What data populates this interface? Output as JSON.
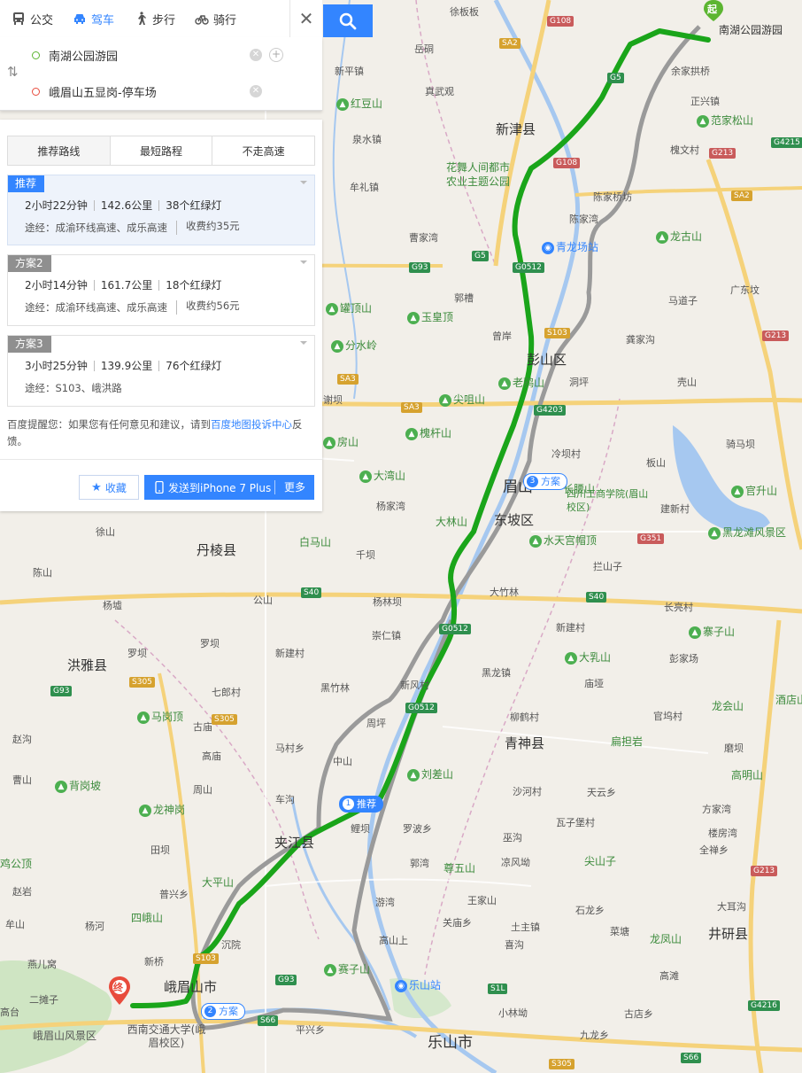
{
  "top_tabs": [
    {
      "label": "公交",
      "icon": "bus-icon"
    },
    {
      "label": "驾车",
      "icon": "car-icon",
      "active": true
    },
    {
      "label": "步行",
      "icon": "walk-icon"
    },
    {
      "label": "骑行",
      "icon": "bike-icon"
    }
  ],
  "route": {
    "origin": "南湖公园游园",
    "destination": "峨眉山五显岗-停车场"
  },
  "options": [
    "推荐路线",
    "最短路程",
    "不走高速"
  ],
  "plans": [
    {
      "badge": "推荐",
      "time": "2小时22分钟",
      "distance": "142.6公里",
      "lights": "38个红绿灯",
      "via": "途经：成渝环线高速、成乐高速",
      "fee": "收费约35元"
    },
    {
      "badge": "方案2",
      "time": "2小时14分钟",
      "distance": "161.7公里",
      "lights": "18个红绿灯",
      "via": "途经：成渝环线高速、成乐高速",
      "fee": "收费约56元"
    },
    {
      "badge": "方案3",
      "time": "3小时25分钟",
      "distance": "139.9公里",
      "lights": "76个红绿灯",
      "via": "途经：S103、峨洪路",
      "fee": ""
    }
  ],
  "tip": {
    "before": "百度提醒您：如果您有任何意见和建议，请到",
    "link": "百度地图投诉中心",
    "after": "反馈。"
  },
  "actions": {
    "favorite": "收藏",
    "send": "发送到iPhone 7 Plus",
    "more": "更多"
  },
  "map": {
    "start_marker": "起",
    "end_marker": "终",
    "route_tags": [
      {
        "num": "1",
        "label": "推荐"
      },
      {
        "num": "2",
        "label": "方案"
      },
      {
        "num": "3",
        "label": "方案"
      }
    ],
    "cities": [
      "新津县",
      "彭山区",
      "眉山",
      "东坡区",
      "丹棱县",
      "洪雅县",
      "青神县",
      "夹江县",
      "峨眉山市",
      "乐山市",
      "井研县"
    ],
    "places": [
      "徐板板",
      "岳硐",
      "真武观",
      "新平镇",
      "泉水镇",
      "牟礼镇",
      "曹家湾",
      "郭槽",
      "曾岸",
      "谢坝",
      "杨家湾",
      "徐山",
      "陈山",
      "杨墟",
      "罗坝",
      "罗坝",
      "高庙",
      "赵沟",
      "周山",
      "曹山",
      "田坝",
      "普兴乡",
      "杨河",
      "新桥",
      "赵岩",
      "牟山",
      "燕儿窝",
      "二摊子",
      "高台",
      "马村乡",
      "车沟",
      "周坪",
      "中山",
      "古庙",
      "七郎村",
      "黑竹林",
      "崇仁镇",
      "杨林坝",
      "千坝",
      "鲤坝",
      "新风村",
      "黑龙镇",
      "柳鹤村",
      "沙河村",
      "罗波乡",
      "郭湾",
      "关庙乡",
      "游湾",
      "沉院",
      "平兴乡",
      "高山上",
      "巫沟",
      "凉风坳",
      "王家山",
      "土主镇",
      "小林坳",
      "石龙乡",
      "菜塘",
      "九龙乡",
      "古店乡",
      "高滩",
      "大耳沟",
      "喜沟",
      "建新村",
      "长亮村",
      "新建村",
      "大竹林",
      "拦山子",
      "彭家场",
      "官坞村",
      "磨坝",
      "庙垭",
      "天云乡",
      "瓦子堡村",
      "方家湾",
      "楼房湾",
      "全禅乡",
      "余家拱桥",
      "正兴镇",
      "槐文村",
      "陈家桥坊",
      "陈家湾",
      "马道子",
      "广东坟",
      "龚家沟",
      "壳山",
      "板山",
      "骑马坝",
      "公山",
      "洞坪",
      "冷坝村",
      "新建村",
      "喻家坝"
    ],
    "scenic": [
      "红豆山",
      "范家松山",
      "龙古山",
      "花舞人间都市农业主题公园",
      "青龙场站",
      "罐顶山",
      "玉皇顶",
      "分水岭",
      "老鸦山",
      "尖咀山",
      "槐杆山",
      "房山",
      "大湾山",
      "长腰山",
      "四川工商学院(眉山校区)",
      "官升山",
      "黑龙滩风景区",
      "水天宫帽顶",
      "大林山",
      "白马山",
      "寨子山",
      "大乳山",
      "龙会山",
      "酒店山",
      "马岗顶",
      "扁担岩",
      "高明山",
      "背岗坡",
      "龙神岗",
      "刘差山",
      "大平山",
      "尖山子",
      "尊五山",
      "鸡公顶",
      "四峨山",
      "龙凤山",
      "赛子山",
      "乐山站",
      "峨眉山风景区",
      "西南交通大学(峨眉校区)"
    ],
    "highway_shields": [
      "G108",
      "SA2",
      "G5",
      "G108",
      "G4215",
      "G213",
      "SA2",
      "G5",
      "G0512",
      "G93",
      "S103",
      "SA3",
      "G4203",
      "SA3",
      "S40",
      "G351",
      "S40",
      "G0512",
      "G93",
      "S305",
      "S305",
      "G0512",
      "S103",
      "G93",
      "S66",
      "S1L",
      "S305",
      "G4216",
      "S66",
      "G213",
      "G213"
    ]
  }
}
